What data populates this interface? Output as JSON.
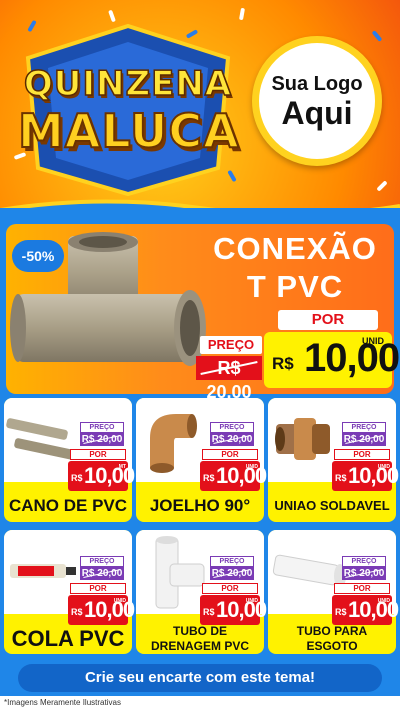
{
  "header": {
    "title_line1": "QUINZENA",
    "title_line2": "MALUCA",
    "logo_line1": "Sua Logo",
    "logo_line2": "Aqui"
  },
  "featured": {
    "discount": "-50%",
    "name_line1": "CONEXÃO",
    "name_line2": "T PVC",
    "preco_label": "PREÇO",
    "old_price": "R$ 20,00",
    "por_label": "POR",
    "unit": "UNID",
    "currency": "R$",
    "price": "10,00"
  },
  "products": [
    {
      "name": "CANO DE PVC",
      "preco_label": "PREÇO",
      "old_price": "R$ 20,00",
      "por_label": "POR",
      "currency": "R$",
      "price": "10,00",
      "unit": "MT",
      "icon": "pipe-icon"
    },
    {
      "name": "JOELHO 90°",
      "preco_label": "PREÇO",
      "old_price": "R$ 20,00",
      "por_label": "POR",
      "currency": "R$",
      "price": "10,00",
      "unit": "UNID",
      "icon": "elbow-icon"
    },
    {
      "name": "UNIAO SOLDAVEL",
      "preco_label": "PREÇO",
      "old_price": "R$ 20,00",
      "por_label": "POR",
      "currency": "R$",
      "price": "10,00",
      "unit": "UNID",
      "icon": "union-icon"
    },
    {
      "name": "COLA PVC",
      "preco_label": "PREÇO",
      "old_price": "R$ 20,00",
      "por_label": "POR",
      "currency": "R$",
      "price": "10,00",
      "unit": "UNID",
      "icon": "glue-icon"
    },
    {
      "name_line1": "TUBO DE",
      "name_line2": "DRENAGEM PVC",
      "preco_label": "PREÇO",
      "old_price": "R$ 20,00",
      "por_label": "POR",
      "currency": "R$",
      "price": "10,00",
      "unit": "UNID",
      "icon": "drain-tube-icon"
    },
    {
      "name_line1": "TUBO PARA",
      "name_line2": "ESGOTO",
      "preco_label": "PREÇO",
      "old_price": "R$ 20,00",
      "por_label": "POR",
      "currency": "R$",
      "price": "10,00",
      "unit": "UNID",
      "icon": "sewer-tube-icon"
    }
  ],
  "cta": "Crie seu encarte com este tema!",
  "footnote": "*Imagens Meramente Ilustrativas",
  "colors": {
    "primary_blue": "#1f86e8",
    "price_red": "#e3101a",
    "highlight_yellow": "#fff200",
    "old_price_purple": "#7a3bb5"
  }
}
